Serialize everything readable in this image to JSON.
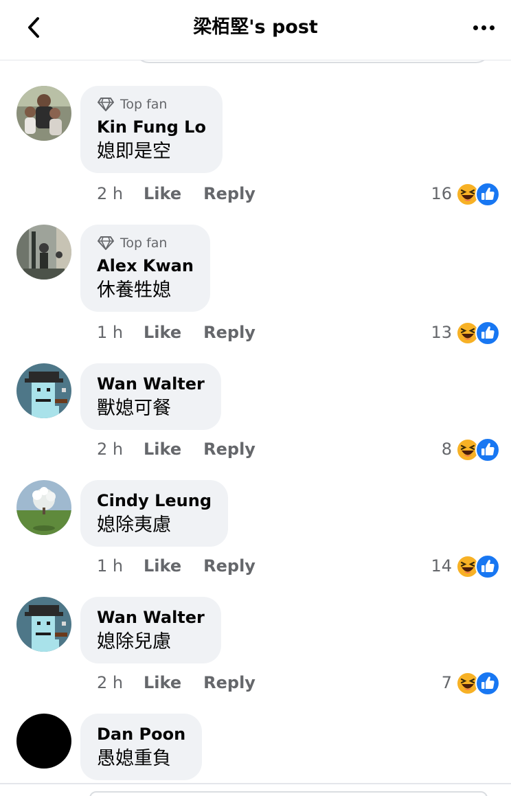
{
  "header": {
    "title": "梁栢堅's post"
  },
  "comments": [
    {
      "top_fan_label": "Top fan",
      "author": "Kin Fung Lo",
      "text": "媳即是空",
      "time": "2 h",
      "like": "Like",
      "reply": "Reply",
      "reaction_count": "16"
    },
    {
      "top_fan_label": "Top fan",
      "author": "Alex Kwan",
      "text": "休養牲媳",
      "time": "1 h",
      "like": "Like",
      "reply": "Reply",
      "reaction_count": "13"
    },
    {
      "author": "Wan Walter",
      "text": "獸媳可餐",
      "time": "2 h",
      "like": "Like",
      "reply": "Reply",
      "reaction_count": "8"
    },
    {
      "author": "Cindy Leung",
      "text": "媳除夷慮",
      "time": "1 h",
      "like": "Like",
      "reply": "Reply",
      "reaction_count": "14"
    },
    {
      "author": "Wan Walter",
      "text": "媳除兒慮",
      "time": "2 h",
      "like": "Like",
      "reply": "Reply",
      "reaction_count": "7"
    },
    {
      "author": "Dan Poon",
      "text": "愚媳重負"
    }
  ],
  "icons": {
    "back": "chevron-left-icon",
    "more": "more-dots-icon",
    "top_fan": "diamond-icon",
    "reactions": [
      "haha-reaction-icon",
      "like-reaction-icon"
    ]
  },
  "colors": {
    "bubble": "#f0f2f5",
    "secondary_text": "#65676b",
    "like_blue": "#1877f2",
    "haha_yellow": "#f7b125"
  }
}
